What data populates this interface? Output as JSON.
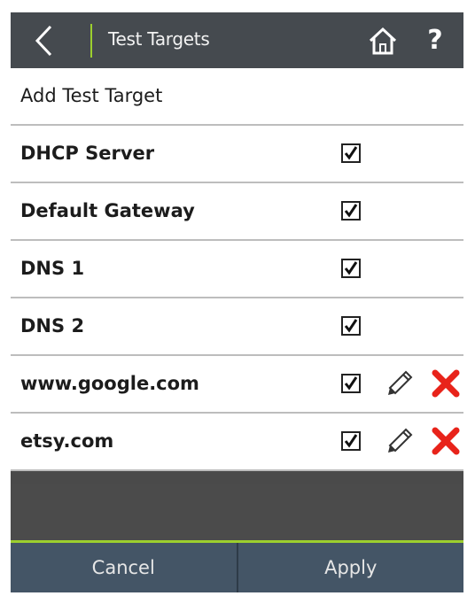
{
  "header": {
    "title": "Test Targets",
    "back_icon": "chevron-left-icon",
    "home_icon": "home-icon",
    "help_label": "?",
    "divider_color": "#9ccf2e"
  },
  "add_target": {
    "label": "Add Test Target"
  },
  "targets": [
    {
      "label": "DHCP Server",
      "checked": true,
      "editable": false
    },
    {
      "label": "Default Gateway",
      "checked": true,
      "editable": false
    },
    {
      "label": "DNS 1",
      "checked": true,
      "editable": false
    },
    {
      "label": "DNS 2",
      "checked": true,
      "editable": false
    },
    {
      "label": "www.google.com",
      "checked": true,
      "editable": true
    },
    {
      "label": "etsy.com",
      "checked": true,
      "editable": true
    }
  ],
  "footer": {
    "cancel_label": "Cancel",
    "apply_label": "Apply"
  },
  "colors": {
    "accent": "#9ccf2e",
    "delete": "#e8231a",
    "footer_bg": "#445566"
  }
}
